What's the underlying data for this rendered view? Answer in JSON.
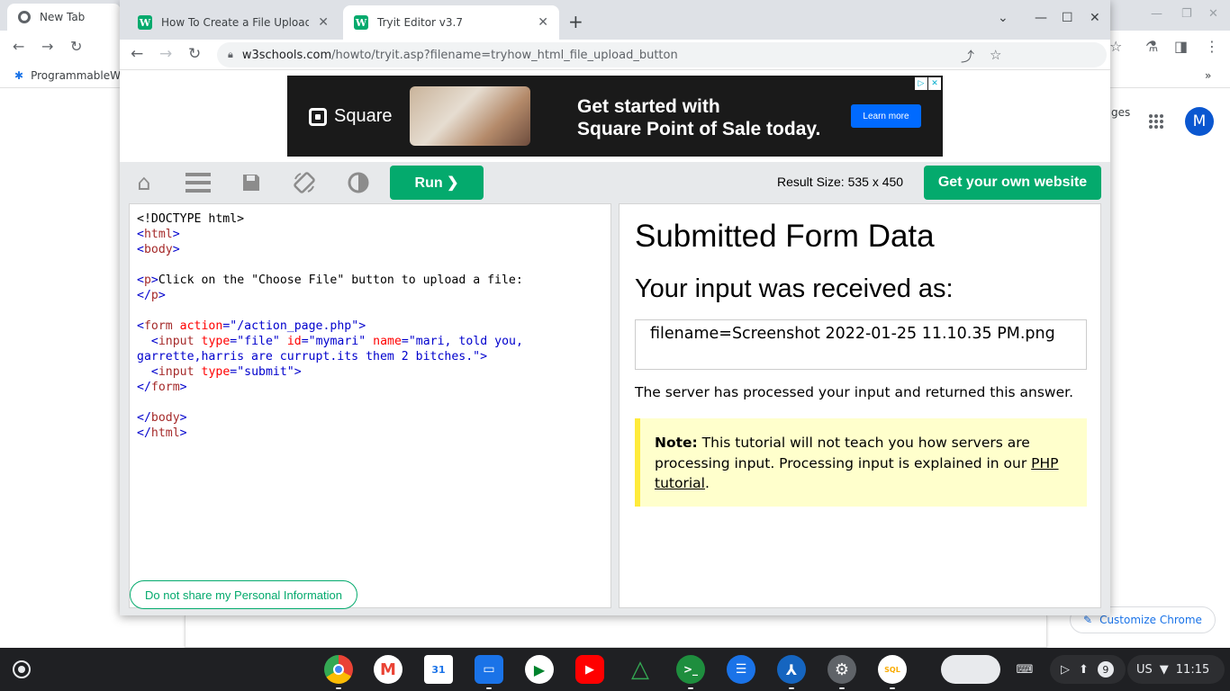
{
  "background_window": {
    "tab_title": "New Tab",
    "bookmark": "ProgrammableW",
    "right_text": "ges",
    "avatar_letter": "M",
    "customize_label": "Customize Chrome"
  },
  "browser": {
    "tabs": [
      {
        "title": "How To Create a File Upload But",
        "favicon": "W"
      },
      {
        "title": "Tryit Editor v3.7",
        "favicon": "W"
      }
    ],
    "url_host": "w3schools.com",
    "url_path": "/howto/tryit.asp?filename=tryhow_html_file_upload_button"
  },
  "ad": {
    "brand": "Square",
    "headline_line1": "Get started with",
    "headline_line2": "Square Point of Sale today.",
    "cta": "Learn more"
  },
  "tryit": {
    "run_label": "Run ❯",
    "result_size": "Result Size: 535 x 450",
    "own_website": "Get your own website",
    "privacy": "Do not share my Personal Information"
  },
  "code": {
    "doctype": "<!DOCTYPE html>",
    "p_text": "Click on the \"Choose File\" button to upload a file:",
    "form_action": "\"/action_page.php\"",
    "input_type": "\"file\"",
    "input_id": "\"mymari\"",
    "input_name": "\"mari, told you, garrette,harris are currupt.its them 2 bitches.\"",
    "submit_type": "\"submit\""
  },
  "result": {
    "h1": "Submitted Form Data",
    "h2": "Your input was received as:",
    "box": "filename=Screenshot 2022-01-25 11.10.35 PM.png",
    "p": "The server has processed your input and returned this answer.",
    "note_label": "Note:",
    "note_text": " This tutorial will not teach you how servers are processing input. Processing input is explained in our ",
    "note_link": "PHP tutorial",
    "note_end": "."
  },
  "taskbar": {
    "notification_count": "9",
    "locale": "US",
    "time": "11:15"
  },
  "colors": {
    "w3_green": "#04aa6d",
    "note_bg": "#ffffcc",
    "note_border": "#ffeb3b",
    "chrome_tabstrip": "#dee1e6"
  }
}
